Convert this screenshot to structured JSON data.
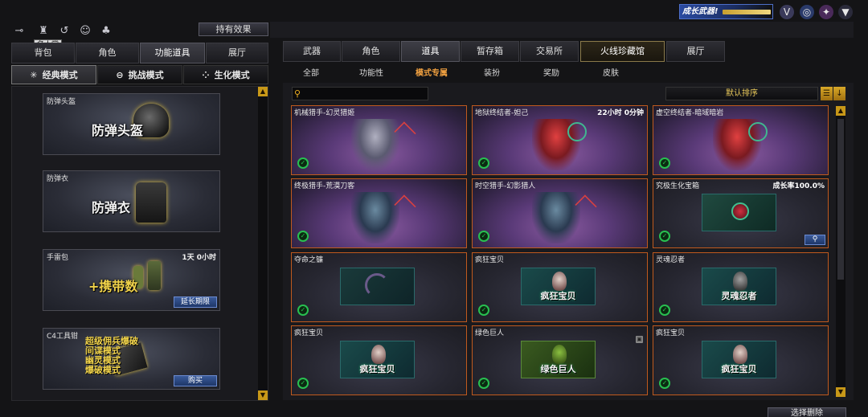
{
  "top_icons": [
    "key-icon",
    "trophy-icon",
    "refresh-icon",
    "person-icon",
    "bag-icon"
  ],
  "tooltip": "名人堂",
  "effect_button": "持有效果",
  "promo": {
    "text": "成长武器!"
  },
  "right_top_icons": [
    "shield-v-icon",
    "globe-icon",
    "compass-icon",
    "v-logo-icon"
  ],
  "left_tabs": [
    "背包",
    "角色",
    "功能道具",
    "展厅"
  ],
  "mode_tabs": [
    {
      "label": "经典模式",
      "icon": "✳"
    },
    {
      "label": "挑战模式",
      "icon": "⊖"
    },
    {
      "label": "生化模式",
      "icon": "⁘"
    }
  ],
  "right_tabs": [
    "武器",
    "角色",
    "道具",
    "暂存箱",
    "交易所",
    "火线珍藏馆",
    "展厅"
  ],
  "sub_tabs": [
    "全部",
    "功能性",
    "模式专属",
    "装扮",
    "奖励",
    "皮肤"
  ],
  "sort_label": "默认排序",
  "equip_cards": [
    {
      "name": "防弹头盔",
      "big": "防弹头盔",
      "time": "",
      "button": ""
    },
    {
      "name": "防弹衣",
      "big": "防弹衣",
      "time": "",
      "button": ""
    },
    {
      "name": "手雷包",
      "big": "+携带数",
      "time": "1天 0小时",
      "button": "延长期限"
    },
    {
      "name": "C4工具钳",
      "big": "",
      "time": "",
      "button": "购买",
      "lines": [
        "超级佣兵爆破",
        "间谍模式",
        "幽灵模式",
        "爆破模式"
      ]
    }
  ],
  "item_cards": [
    {
      "name": "机械猎手-幻灵猎姬",
      "extra": "",
      "style": "special",
      "art": "figure"
    },
    {
      "name": "地狱终结者-妲己",
      "extra": "22小时 0分钟",
      "style": "special",
      "art": "figure-red"
    },
    {
      "name": "虚空终结者-暗域暗岩",
      "extra": "",
      "style": "special",
      "art": "figure-red"
    },
    {
      "name": "终极猎手-荒漠刀客",
      "extra": "",
      "style": "special",
      "art": "figure-teal"
    },
    {
      "name": "时空猎手-幻影猎人",
      "extra": "",
      "style": "special",
      "art": "figure-teal"
    },
    {
      "name": "究极生化宝箱",
      "extra": "成长率100.0%",
      "style": "normal",
      "art": "chest"
    },
    {
      "name": "夺命之镰",
      "extra": "",
      "style": "normal",
      "art": "scythe"
    },
    {
      "name": "疯狂宝贝",
      "extra": "",
      "style": "normal",
      "art": "panel",
      "panel_text": "疯狂宝贝"
    },
    {
      "name": "灵魂忍者",
      "extra": "",
      "style": "normal",
      "art": "panel",
      "panel_text": "灵魂忍者"
    },
    {
      "name": "疯狂宝贝",
      "extra": "",
      "style": "normal",
      "art": "panel",
      "panel_text": "疯狂宝贝"
    },
    {
      "name": "绿色巨人",
      "extra": "",
      "style": "normal",
      "art": "green-panel",
      "panel_text": "绿色巨人"
    },
    {
      "name": "疯狂宝贝",
      "extra": "",
      "style": "normal",
      "art": "panel",
      "panel_text": "疯狂宝贝"
    }
  ],
  "bottom_button": "选择删除",
  "colors": {
    "card_border": "#c05a1e",
    "accent_gold": "#f0a040",
    "badge_green": "#28c050"
  }
}
